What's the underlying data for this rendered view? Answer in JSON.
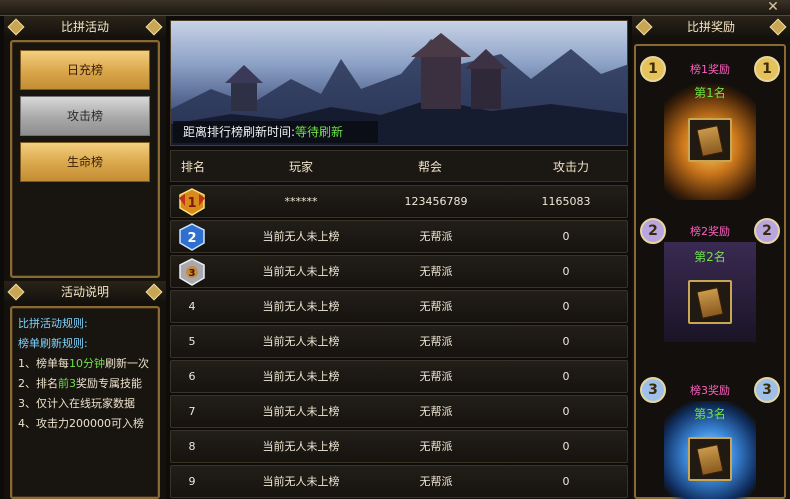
{
  "window": {
    "close_glyph": "✕"
  },
  "left": {
    "title": "比拼活动",
    "tabs": [
      {
        "label": "日充榜",
        "state": "normal"
      },
      {
        "label": "攻击榜",
        "state": "selected"
      },
      {
        "label": "生命榜",
        "state": "normal"
      }
    ],
    "info_title": "活动说明",
    "rules_title": "比拼活动规则:",
    "refresh_title": "榜单刷新规则:",
    "rule1": {
      "pre": "1、榜单每",
      "hl": "10分钟",
      "post": "刷新一次"
    },
    "rule2": {
      "pre": "2、排名",
      "hl": "前3",
      "post": "奖励专属技能"
    },
    "rule3": "3、仅计入在线玩家数据",
    "rule4": "4、攻击力200000可入榜"
  },
  "banner": {
    "label": "距离排行榜刷新时间:",
    "status": "等待刷新"
  },
  "table": {
    "headers": {
      "rank": "排名",
      "player": "玩家",
      "guild": "帮会",
      "power": "攻击力"
    },
    "rows": [
      {
        "rank": "1",
        "player": "******",
        "guild": "123456789",
        "power": "1165083",
        "medal": "gold"
      },
      {
        "rank": "2",
        "player": "当前无人未上榜",
        "guild": "无帮派",
        "power": "0",
        "medal": "blue"
      },
      {
        "rank": "3",
        "player": "当前无人未上榜",
        "guild": "无帮派",
        "power": "0",
        "medal": "bronze"
      },
      {
        "rank": "4",
        "player": "当前无人未上榜",
        "guild": "无帮派",
        "power": "0"
      },
      {
        "rank": "5",
        "player": "当前无人未上榜",
        "guild": "无帮派",
        "power": "0"
      },
      {
        "rank": "6",
        "player": "当前无人未上榜",
        "guild": "无帮派",
        "power": "0"
      },
      {
        "rank": "7",
        "player": "当前无人未上榜",
        "guild": "无帮派",
        "power": "0"
      },
      {
        "rank": "8",
        "player": "当前无人未上榜",
        "guild": "无帮派",
        "power": "0"
      },
      {
        "rank": "9",
        "player": "当前无人未上榜",
        "guild": "无帮派",
        "power": "0"
      }
    ]
  },
  "rewards": {
    "title": "比拼奖励",
    "items": [
      {
        "head": "榜1奖励",
        "num": "1",
        "place": "第1名",
        "color": "#f0c850"
      },
      {
        "head": "榜2奖励",
        "num": "2",
        "place": "第2名",
        "color": "#c9b7e8"
      },
      {
        "head": "榜3奖励",
        "num": "3",
        "place": "第3名",
        "color": "#a9c9ef"
      }
    ]
  }
}
